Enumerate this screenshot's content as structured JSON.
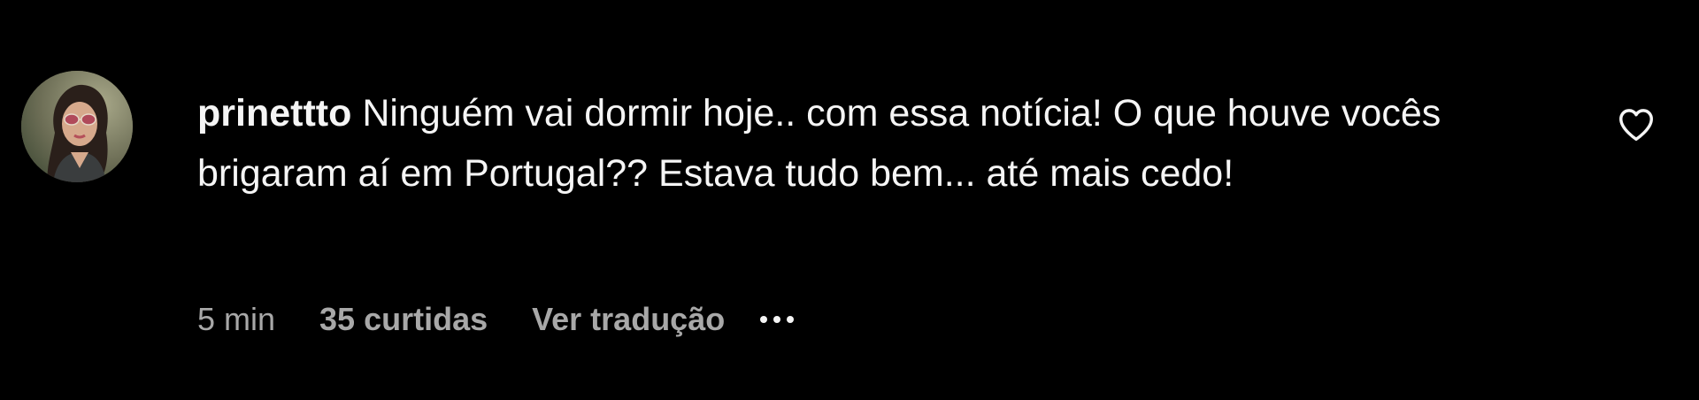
{
  "comment": {
    "username": "prinettto",
    "text": "Ninguém vai dormir hoje.. com essa notícia! O que houve vocês brigaram aí em Portugal?? Estava tudo bem... até mais cedo!",
    "time": "5 min",
    "likes": "35 curtidas",
    "translate_label": "Ver tradução",
    "more_icon": "more-dots-icon",
    "like_icon": "heart-outline-icon"
  },
  "colors": {
    "background": "#000000",
    "primary_text": "#f5f5f5",
    "secondary_text": "#a8a8a8"
  }
}
